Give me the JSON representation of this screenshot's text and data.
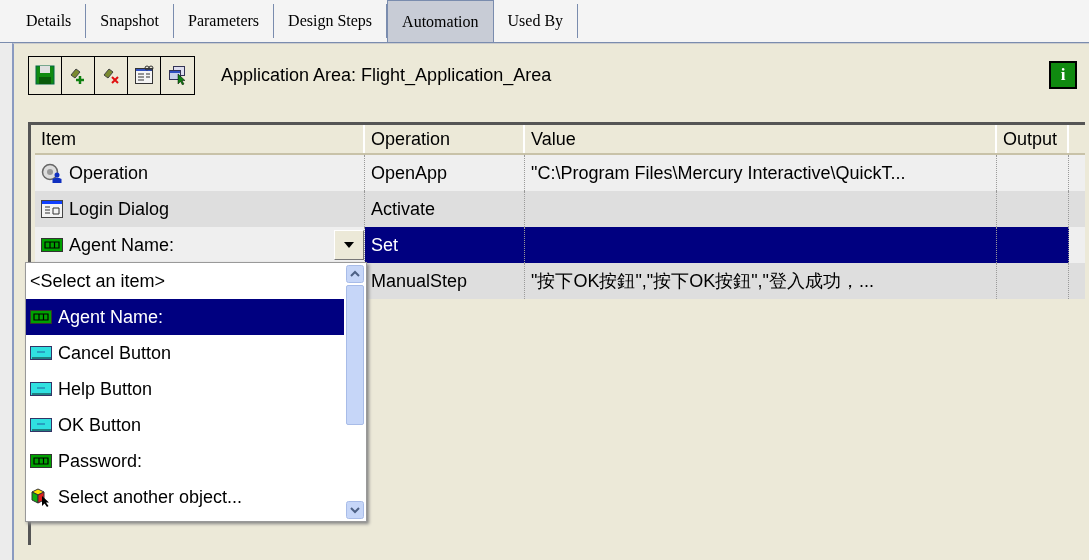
{
  "tabs": [
    {
      "label": "Details",
      "selected": false
    },
    {
      "label": "Snapshot",
      "selected": false
    },
    {
      "label": "Parameters",
      "selected": false
    },
    {
      "label": "Design Steps",
      "selected": false
    },
    {
      "label": "Automation",
      "selected": true
    },
    {
      "label": "Used By",
      "selected": false
    }
  ],
  "toolbar": {
    "buttons": [
      {
        "kind": "save"
      },
      {
        "kind": "add"
      },
      {
        "kind": "remove"
      },
      {
        "kind": "properties"
      },
      {
        "kind": "select"
      }
    ],
    "application_area": "Application Area: Flight_Application_Area",
    "info_button": "i"
  },
  "grid": {
    "columns": [
      "Item",
      "Operation",
      "Value",
      "Output"
    ],
    "rows": [
      {
        "kind": "operation",
        "item": "Operation",
        "operation": "OpenApp",
        "value": "\"C:\\Program Files\\Mercury Interactive\\QuickT...",
        "selected": false
      },
      {
        "kind": "dialog",
        "item": "Login Dialog",
        "operation": "Activate",
        "selected": false
      },
      {
        "kind": "edit",
        "item": "Agent Name:",
        "operation": "Set",
        "selected": true,
        "dropdown_open": true
      },
      {
        "operation": "ManualStep",
        "value": "\"按下OK按鈕\",\"按下OK按鈕\",\"登入成功，...",
        "selected": false
      }
    ]
  },
  "dropdown": {
    "items": [
      {
        "kind": "text",
        "label": "<Select an item>",
        "selected": false
      },
      {
        "kind": "edit",
        "label": "Agent Name:",
        "selected": true
      },
      {
        "kind": "button",
        "label": "Cancel Button",
        "selected": false
      },
      {
        "kind": "button",
        "label": "Help Button",
        "selected": false
      },
      {
        "kind": "button",
        "label": "OK Button",
        "selected": false
      },
      {
        "kind": "edit",
        "label": "Password:",
        "selected": false
      },
      {
        "kind": "pick",
        "label": "Select another object...",
        "selected": false
      }
    ]
  }
}
